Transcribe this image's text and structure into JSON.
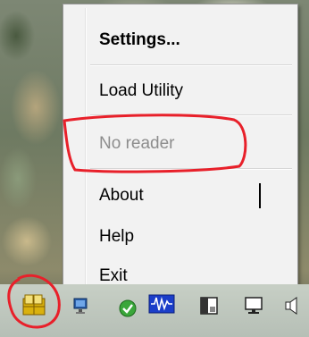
{
  "menu": {
    "items": [
      {
        "label": "Settings...",
        "bold": true,
        "enabled": true
      },
      {
        "label": "Load Utility",
        "enabled": true
      },
      {
        "label": "No reader",
        "enabled": false
      },
      {
        "label": "About",
        "enabled": true
      },
      {
        "label": "Help",
        "enabled": true
      },
      {
        "label": "Exit",
        "enabled": true
      }
    ]
  },
  "tray": {
    "icons": [
      "smart-card-reader-icon",
      "network-icon",
      "security-shield-icon",
      "audio-wave-icon",
      "device-icon",
      "monitor-icon",
      "speaker-icon"
    ]
  },
  "annotation_color": "#e8202a"
}
